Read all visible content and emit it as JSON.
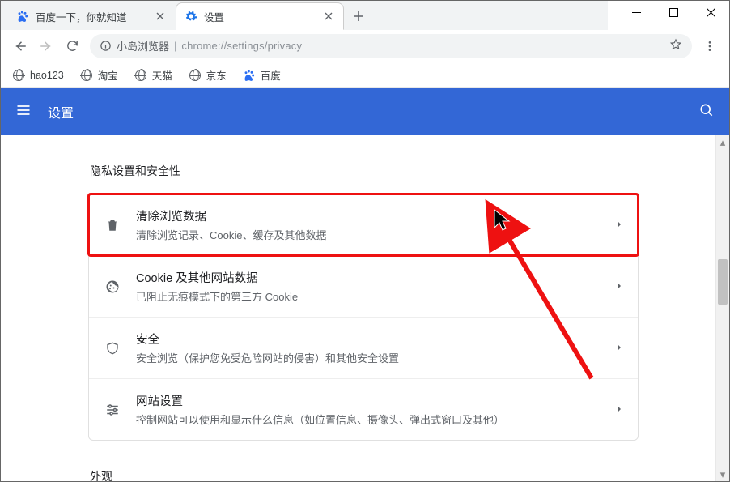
{
  "window": {
    "tabs": [
      {
        "title": "百度一下，你就知道",
        "favicon": "baidu"
      },
      {
        "title": "设置",
        "favicon": "gear"
      }
    ],
    "active_tab": 1
  },
  "addressbar": {
    "origin_label": "小岛浏览器",
    "path": "chrome://settings/privacy"
  },
  "bookmarks": [
    {
      "label": "hao123",
      "icon": "globe"
    },
    {
      "label": "淘宝",
      "icon": "globe"
    },
    {
      "label": "天猫",
      "icon": "globe"
    },
    {
      "label": "京东",
      "icon": "globe"
    },
    {
      "label": "百度",
      "icon": "baidu"
    }
  ],
  "header": {
    "title": "设置"
  },
  "main": {
    "section_title": "隐私设置和安全性",
    "rows": [
      {
        "icon": "trash",
        "title": "清除浏览数据",
        "desc": "清除浏览记录、Cookie、缓存及其他数据"
      },
      {
        "icon": "cookie",
        "title": "Cookie 及其他网站数据",
        "desc": "已阻止无痕模式下的第三方 Cookie"
      },
      {
        "icon": "shield",
        "title": "安全",
        "desc": "安全浏览（保护您免受危险网站的侵害）和其他安全设置"
      },
      {
        "icon": "tune",
        "title": "网站设置",
        "desc": "控制网站可以使用和显示什么信息（如位置信息、摄像头、弹出式窗口及其他）"
      }
    ],
    "next_section_title": "外观"
  }
}
